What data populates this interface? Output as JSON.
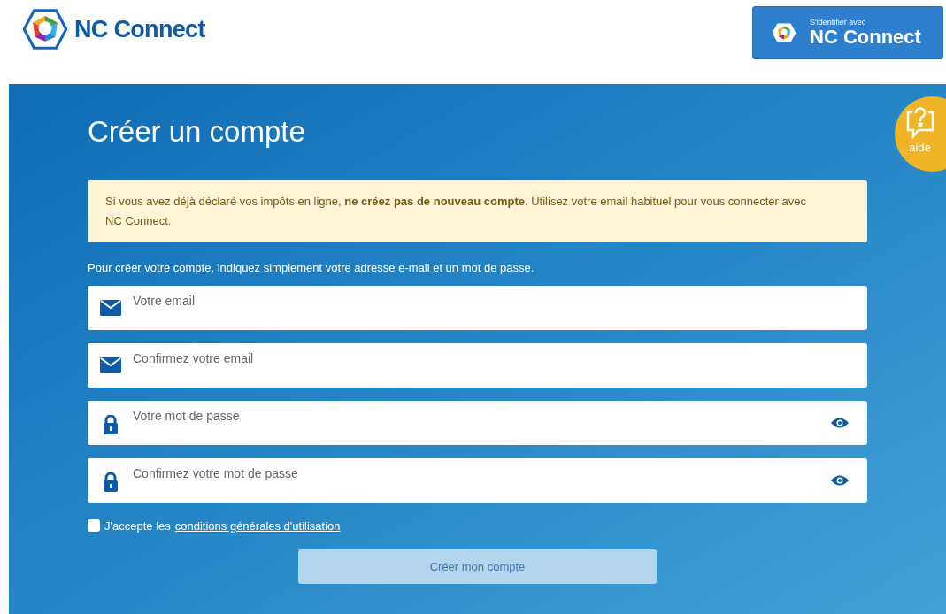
{
  "header": {
    "logo_text": "NC Connect",
    "login_button": {
      "small": "S'identifier avec",
      "big": "NC Connect"
    }
  },
  "help": {
    "label": "aide"
  },
  "title": "Créer un compte",
  "warning": "Si vous avez déjà déclaré vos impôts en ligne, **ne créez pas de nouveau compte**. Utilisez votre email habituel pour vous connecter avec NC Connect.",
  "intro": "Pour créer votre compte, indiquez simplement votre adresse e-mail et un mot de passe.",
  "fields": [
    {
      "kind": "email",
      "placeholder": "Votre email"
    },
    {
      "kind": "email",
      "placeholder": "Confirmez votre email"
    },
    {
      "kind": "password",
      "placeholder": "Votre mot de passe"
    },
    {
      "kind": "password",
      "placeholder": "Confirmez votre mot de passe"
    }
  ],
  "consent": {
    "checked": false,
    "text": "J'accepte les",
    "link": "conditions générales d'utilisation"
  },
  "submit": {
    "label": "Créer mon compte",
    "disabled": true
  }
}
